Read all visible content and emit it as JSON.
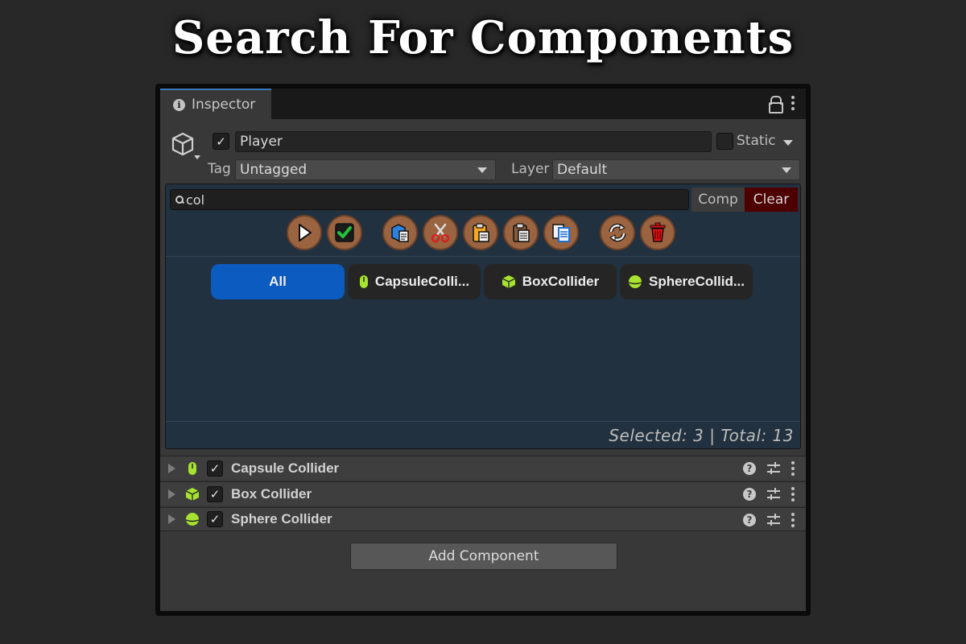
{
  "page_title": "Search For Components",
  "tab": {
    "label": "Inspector"
  },
  "object": {
    "name": "Player",
    "active": true,
    "static_label": "Static",
    "static_checked": false
  },
  "tag": {
    "label": "Tag",
    "value": "Untagged"
  },
  "layer": {
    "label": "Layer",
    "value": "Default"
  },
  "search": {
    "value": "col",
    "comp_label": "Comp",
    "clear_label": "Clear"
  },
  "toolbar": [
    "play-icon",
    "checkbox-check-icon",
    "copy-icon",
    "cut-icon",
    "paste-icon",
    "paste-values-icon",
    "duplicate-icon",
    "reset-icon",
    "delete-icon"
  ],
  "filters": [
    {
      "label": "All",
      "active": true
    },
    {
      "label": "CapsuleColli...",
      "icon": "capsule-icon"
    },
    {
      "label": "BoxCollider",
      "icon": "box-icon"
    },
    {
      "label": "SphereCollid...",
      "icon": "sphere-icon"
    }
  ],
  "status": "Selected: 3 | Total: 13",
  "components": [
    {
      "name": "Capsule Collider",
      "icon": "capsule-icon",
      "enabled": true
    },
    {
      "name": "Box Collider",
      "icon": "box-icon",
      "enabled": true
    },
    {
      "name": "Sphere Collider",
      "icon": "sphere-icon",
      "enabled": true
    }
  ],
  "add_component_label": "Add Component",
  "colors": {
    "accent": "#0b5bc0",
    "tool_bg": "#9a6440",
    "collider_green": "#a6e22e",
    "clear_red": "#4e0000",
    "panel_bg": "#22313f"
  }
}
